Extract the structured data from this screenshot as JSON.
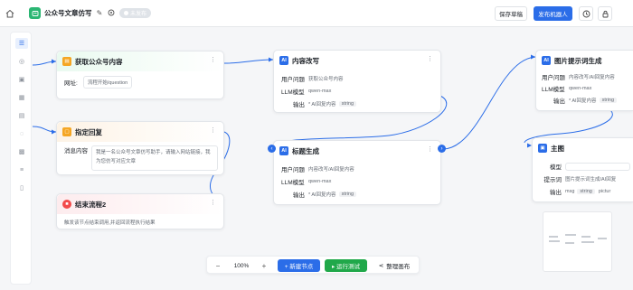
{
  "header": {
    "title": "公众号文章仿写",
    "status": "未发布",
    "save_label": "保存草稿",
    "publish_label": "发布机器人"
  },
  "nodes": {
    "fetch": {
      "title": "获取公众号内容",
      "icon": "document-icon",
      "color": "#f5a623",
      "url_label": "网址:",
      "url_value": "流程开始/question"
    },
    "reply": {
      "title": "指定回复",
      "icon": "message-icon",
      "color": "#f5a623",
      "content_label": "消息内容",
      "content_value_line1": "我是一名公众号文章仿写助手，请输入网站链接，我",
      "content_value_line2": "为您仿写对应文章"
    },
    "end": {
      "title": "结束流程2",
      "icon": "stop-icon",
      "color": "#f24a4a",
      "desc": "触发该节点结束调用,并返回流程执行结果"
    },
    "rewrite": {
      "title": "内容改写",
      "icon": "ai-icon",
      "badge": "AI",
      "color": "#2b6de8",
      "question_label": "用户问题",
      "question_value": "获取公众号内容",
      "model_label": "LLM模型",
      "model_value": "qwen-max",
      "output_label": "输出",
      "output_value": "* AI回复内容",
      "output_type": "string"
    },
    "title_gen": {
      "title": "标题生成",
      "icon": "ai-icon",
      "badge": "AI",
      "color": "#2b6de8",
      "question_label": "用户问题",
      "question_value": "内容改写/AI回复内容",
      "model_label": "LLM模型",
      "model_value": "qwen-max",
      "output_label": "输出",
      "output_value": "* AI回复内容",
      "output_type": "string"
    },
    "image_prompt": {
      "title": "图片提示词生成",
      "icon": "ai-icon",
      "badge": "AI",
      "color": "#2b6de8",
      "question_label": "用户问题",
      "question_value": "内容改写/AI回复内容",
      "model_label": "LLM模型",
      "model_value": "qwen-max",
      "output_label": "输出",
      "output_value": "* AI回复内容",
      "output_type": "string"
    },
    "main_image": {
      "title": "主图",
      "icon": "image-icon",
      "color": "#2b6de8",
      "model_label": "模型",
      "prompt_label": "提示词",
      "prompt_value": "图片提示词生成/AI回复",
      "output_label": "输出",
      "output_value": "msg",
      "output_type": "string",
      "output_extra": "pictur"
    }
  },
  "bottom_toolbar": {
    "zoom_out": "−",
    "zoom_level": "100%",
    "zoom_in": "+",
    "new_node": "+ 新建节点",
    "run_test": "▸ 运行测试",
    "tidy": "整理画布"
  }
}
